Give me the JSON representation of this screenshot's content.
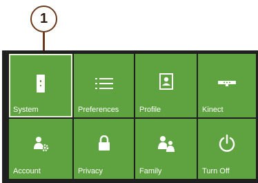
{
  "callout": {
    "number": "1"
  },
  "tiles": [
    {
      "label": "System",
      "icon": "console-icon",
      "selected": true
    },
    {
      "label": "Preferences",
      "icon": "list-icon"
    },
    {
      "label": "Profile",
      "icon": "profile-card-icon"
    },
    {
      "label": "Kinect",
      "icon": "kinect-sensor-icon"
    },
    {
      "label": "Account",
      "icon": "account-gear-icon"
    },
    {
      "label": "Privacy",
      "icon": "lock-icon"
    },
    {
      "label": "Family",
      "icon": "family-icon"
    },
    {
      "label": "Turn Off",
      "icon": "power-icon"
    }
  ],
  "colors": {
    "tile_green": "#5ea33f",
    "panel_dark": "#1f1f1f",
    "callout_line": "#6b3a1c"
  }
}
